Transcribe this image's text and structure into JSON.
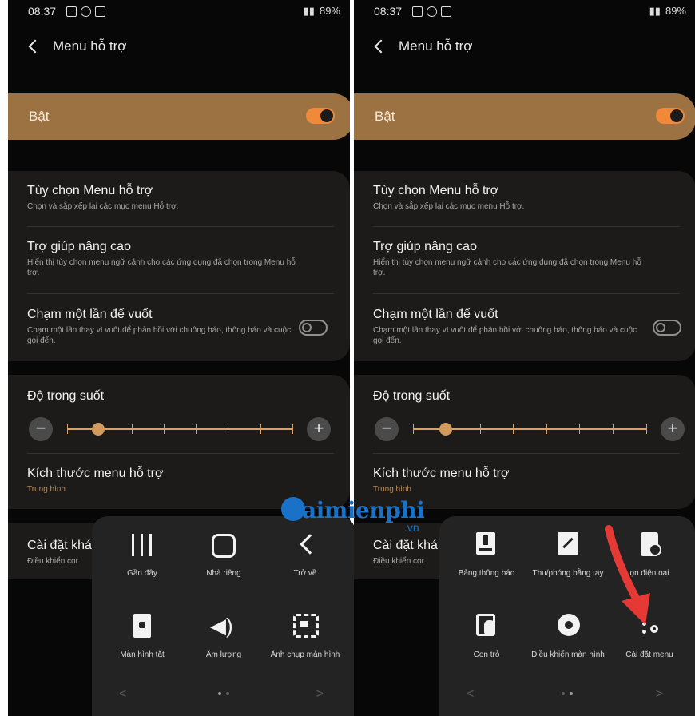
{
  "status_bar": {
    "time": "08:37",
    "battery": "89%"
  },
  "header": {
    "title": "Menu hỗ trợ"
  },
  "master_switch": {
    "label": "Bật",
    "state": "on"
  },
  "settings": {
    "options": {
      "title": "Tùy chọn Menu hỗ trợ",
      "subtitle": "Chọn và sắp xếp lại các mục menu Hỗ trợ."
    },
    "advanced": {
      "title": "Trợ giúp nâng cao",
      "subtitle": "Hiển thị tùy chọn menu ngữ cảnh cho các ứng dụng đã chọn trong Menu hỗ trợ."
    },
    "single_tap": {
      "title": "Chạm một lần để vuốt",
      "subtitle": "Chạm một lần thay vì vuốt để phản hồi với chuông báo, thông báo và cuộc gọi đến.",
      "state": "off"
    },
    "transparency": {
      "title": "Độ trong suốt",
      "level": 0.14,
      "minus_symbol": "−",
      "plus_symbol": "+"
    },
    "size": {
      "title": "Kích thước menu hỗ trợ",
      "value": "Trung bình"
    },
    "other": {
      "title": "Cài đặt khá",
      "subtitle": "Điều khiển cor"
    }
  },
  "assistant_menu_left": {
    "items": [
      {
        "label": "Gần đây",
        "icon": "recents-icon"
      },
      {
        "label": "Nhà riêng",
        "icon": "home-icon"
      },
      {
        "label": "Trở về",
        "icon": "back-icon"
      },
      {
        "label": "Màn hình tắt",
        "icon": "lock-screen-icon"
      },
      {
        "label": "Âm lượng",
        "icon": "volume-icon"
      },
      {
        "label": "Ảnh chụp màn hình",
        "icon": "screenshot-icon"
      }
    ],
    "nav_prev": "<",
    "nav_next": ">"
  },
  "assistant_menu_right": {
    "items": [
      {
        "label": "Bảng thông báo",
        "icon": "notification-panel-icon"
      },
      {
        "label": "Thu/phóng bằng tay",
        "icon": "zoom-icon"
      },
      {
        "label": "ọn điện oại",
        "icon": "phone-settings-icon"
      },
      {
        "label": "Con trỏ",
        "icon": "cursor-icon"
      },
      {
        "label": "Điều khiển màn hình",
        "icon": "screen-control-icon"
      },
      {
        "label": "Cài đặt menu",
        "icon": "menu-settings-icon"
      }
    ],
    "nav_prev": "<",
    "nav_next": ">"
  },
  "watermark": {
    "brand": "aimienphi",
    "suffix": ".vn"
  },
  "colors": {
    "accent": "#9d7243",
    "toggle_on": "#f08a3a",
    "slider": "#d3a26e",
    "card": "#1c1b19",
    "background": "#070707",
    "watermark": "#1a72c8",
    "arrow": "#e53935"
  }
}
